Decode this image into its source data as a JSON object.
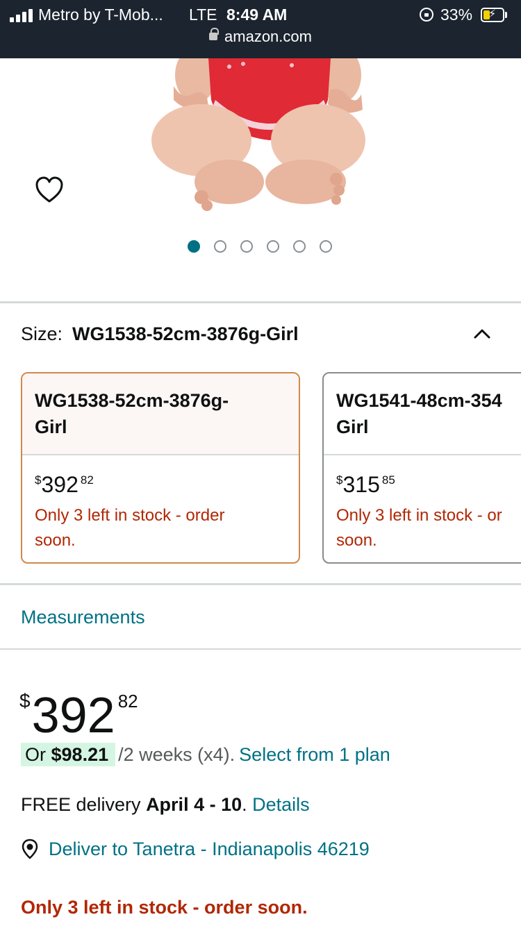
{
  "status_bar": {
    "carrier": "Metro by T-Mob...",
    "network": "LTE",
    "time": "8:49 AM",
    "battery_percent": "33%",
    "battery_level": 0.33,
    "url": "amazon.com"
  },
  "gallery": {
    "image_count": 6,
    "active_index": 0
  },
  "size_selector": {
    "label": "Size:",
    "selected_value": "WG1538-52cm-3876g-Girl",
    "options": [
      {
        "name_line1": "WG1538-52cm-3876g-",
        "name_line2": "Girl",
        "currency": "$",
        "price_whole": "392",
        "price_cents": "82",
        "stock_line1": "Only 3 left in stock - order",
        "stock_line2": "soon.",
        "selected": true
      },
      {
        "name_line1": "WG1541-48cm-354",
        "name_line2": "Girl",
        "currency": "$",
        "price_whole": "315",
        "price_cents": "85",
        "stock_line1": "Only 3 left in stock - or",
        "stock_line2": "soon.",
        "selected": false
      }
    ]
  },
  "measurements_link": "Measurements",
  "price": {
    "currency": "$",
    "whole": "392",
    "cents": "82"
  },
  "installment": {
    "or_label": "Or",
    "amount": "$98.21",
    "period": "/2 weeks (x4).",
    "plan_link": "Select from 1 plan"
  },
  "delivery": {
    "prefix": "FREE delivery",
    "date": "April 4 - 10",
    "period": ".",
    "details_link": "Details"
  },
  "deliver_to": "Deliver to Tanetra - Indianapolis 46219",
  "stock_message": "Only 3 left in stock - order soon.",
  "colors": {
    "status_bar_bg": "#1b242f",
    "link": "#007185",
    "stock_red": "#b12704",
    "selected_border": "#d0894a",
    "installment_badge": "#d5f5e3",
    "dot_active": "#007185"
  }
}
